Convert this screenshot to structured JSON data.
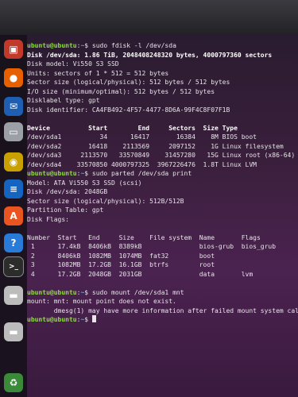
{
  "dock": {
    "items": [
      {
        "name": "app-grid-icon",
        "glyph": "▣",
        "color": "#c0392b"
      },
      {
        "name": "firefox-icon",
        "glyph": "●",
        "color": "#e66000"
      },
      {
        "name": "thunderbird-icon",
        "glyph": "✉",
        "color": "#1e5fb4"
      },
      {
        "name": "files-icon",
        "glyph": "▭",
        "color": "#9aa0a6"
      },
      {
        "name": "rhythmbox-icon",
        "glyph": "◉",
        "color": "#c8a000"
      },
      {
        "name": "writer-icon",
        "glyph": "≡",
        "color": "#1565c0"
      },
      {
        "name": "software-icon",
        "glyph": "A",
        "color": "#e95420"
      },
      {
        "name": "help-icon",
        "glyph": "?",
        "color": "#2a7ad8"
      },
      {
        "name": "terminal-icon",
        "glyph": ">_",
        "color": "#2c2c2c"
      },
      {
        "name": "drive-icon",
        "glyph": "▬",
        "color": "#bcbcbc"
      },
      {
        "name": "drive-icon-2",
        "glyph": "▬",
        "color": "#bcbcbc"
      },
      {
        "name": "trash-icon",
        "glyph": "♻",
        "color": "#3a8a3a"
      }
    ]
  },
  "prompt": {
    "user": "ubuntu@ubuntu",
    "sep": ":",
    "path": "~",
    "sym": "$ "
  },
  "lines": [
    {
      "type": "cmd",
      "text": "sudo fdisk -l /dev/sda"
    },
    {
      "type": "bold",
      "text": "Disk /dev/sda: 1.86 TiB, 2048408248320 bytes, 4000797360 sectors"
    },
    {
      "type": "text",
      "text": "Disk model: Vi550 S3 SSD"
    },
    {
      "type": "text",
      "text": "Units: sectors of 1 * 512 = 512 bytes"
    },
    {
      "type": "text",
      "text": "Sector size (logical/physical): 512 bytes / 512 bytes"
    },
    {
      "type": "text",
      "text": "I/O size (minimum/optimal): 512 bytes / 512 bytes"
    },
    {
      "type": "text",
      "text": "Disklabel type: gpt"
    },
    {
      "type": "text",
      "text": "Disk identifier: CA4FB492-4F57-4477-8D6A-99F4C8F07F1B"
    },
    {
      "type": "text",
      "text": ""
    },
    {
      "type": "bold",
      "text": "Device          Start        End     Sectors  Size Type"
    },
    {
      "type": "text",
      "text": "/dev/sda1          34      16417       16384    8M BIOS boot"
    },
    {
      "type": "text",
      "text": "/dev/sda2       16418    2113569     2097152    1G Linux filesystem"
    },
    {
      "type": "text",
      "text": "/dev/sda3     2113570   33570849    31457280   15G Linux root (x86-64)"
    },
    {
      "type": "text",
      "text": "/dev/sda4    33570850 4000797325  3967226476  1.8T Linux LVM"
    },
    {
      "type": "cmd",
      "text": "sudo parted /dev/sda print"
    },
    {
      "type": "text",
      "text": "Model: ATA Vi550 S3 SSD (scsi)"
    },
    {
      "type": "text",
      "text": "Disk /dev/sda: 2048GB"
    },
    {
      "type": "text",
      "text": "Sector size (logical/physical): 512B/512B"
    },
    {
      "type": "text",
      "text": "Partition Table: gpt"
    },
    {
      "type": "text",
      "text": "Disk Flags:"
    },
    {
      "type": "text",
      "text": ""
    },
    {
      "type": "text",
      "text": "Number  Start   End     Size    File system  Name       Flags"
    },
    {
      "type": "text",
      "text": " 1      17.4kB  8406kB  8389kB               bios-grub  bios_grub"
    },
    {
      "type": "text",
      "text": " 2      8406kB  1082MB  1074MB  fat32        boot"
    },
    {
      "type": "text",
      "text": " 3      1082MB  17.2GB  16.1GB  btrfs        root"
    },
    {
      "type": "text",
      "text": " 4      17.2GB  2048GB  2031GB               data       lvm"
    },
    {
      "type": "text",
      "text": ""
    },
    {
      "type": "cmd",
      "text": "sudo mount /dev/sda1 mnt"
    },
    {
      "type": "text",
      "text": "mount: mnt: mount point does not exist."
    },
    {
      "type": "text",
      "text": "       dmesg(1) may have more information after failed mount system call."
    },
    {
      "type": "cmd",
      "text": "",
      "cursor": true
    }
  ]
}
